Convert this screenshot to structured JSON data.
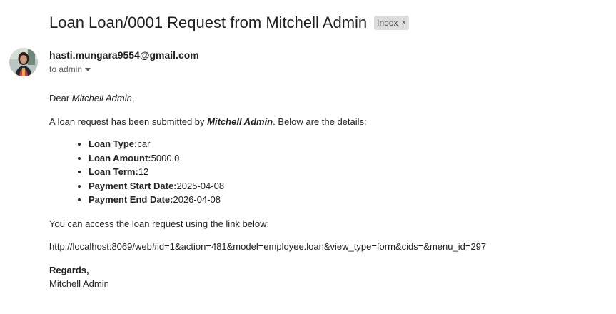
{
  "email": {
    "subject": "Loan Loan/0001 Request from Mitchell Admin",
    "label": "Inbox",
    "sender": "hasti.mungara9554@gmail.com",
    "recipient": "to admin"
  },
  "body": {
    "dear_prefix": "Dear ",
    "dear_name": "Mitchell Admin",
    "dear_suffix": ",",
    "intro_prefix": "A loan request has been submitted by ",
    "intro_name": "Mitchell Admin",
    "intro_suffix": ". Below are the details:",
    "details": [
      {
        "label": "Loan Type:",
        "value": "car"
      },
      {
        "label": "Loan Amount:",
        "value": "5000.0"
      },
      {
        "label": "Loan Term:",
        "value": "12"
      },
      {
        "label": "Payment Start Date:",
        "value": "2025-04-08"
      },
      {
        "label": "Payment End Date:",
        "value": "2026-04-08"
      }
    ],
    "access_text": "You can access the loan request using the link below:",
    "link": "http://localhost:8069/web#id=1&action=481&model=employee.loan&view_type=form&cids=&menu_id=297",
    "regards": "Regards,",
    "signature": "Mitchell Admin"
  },
  "icons": {
    "label_close": "close-icon",
    "recipient_toggle": "chevron-down-icon",
    "avatar": "avatar"
  }
}
